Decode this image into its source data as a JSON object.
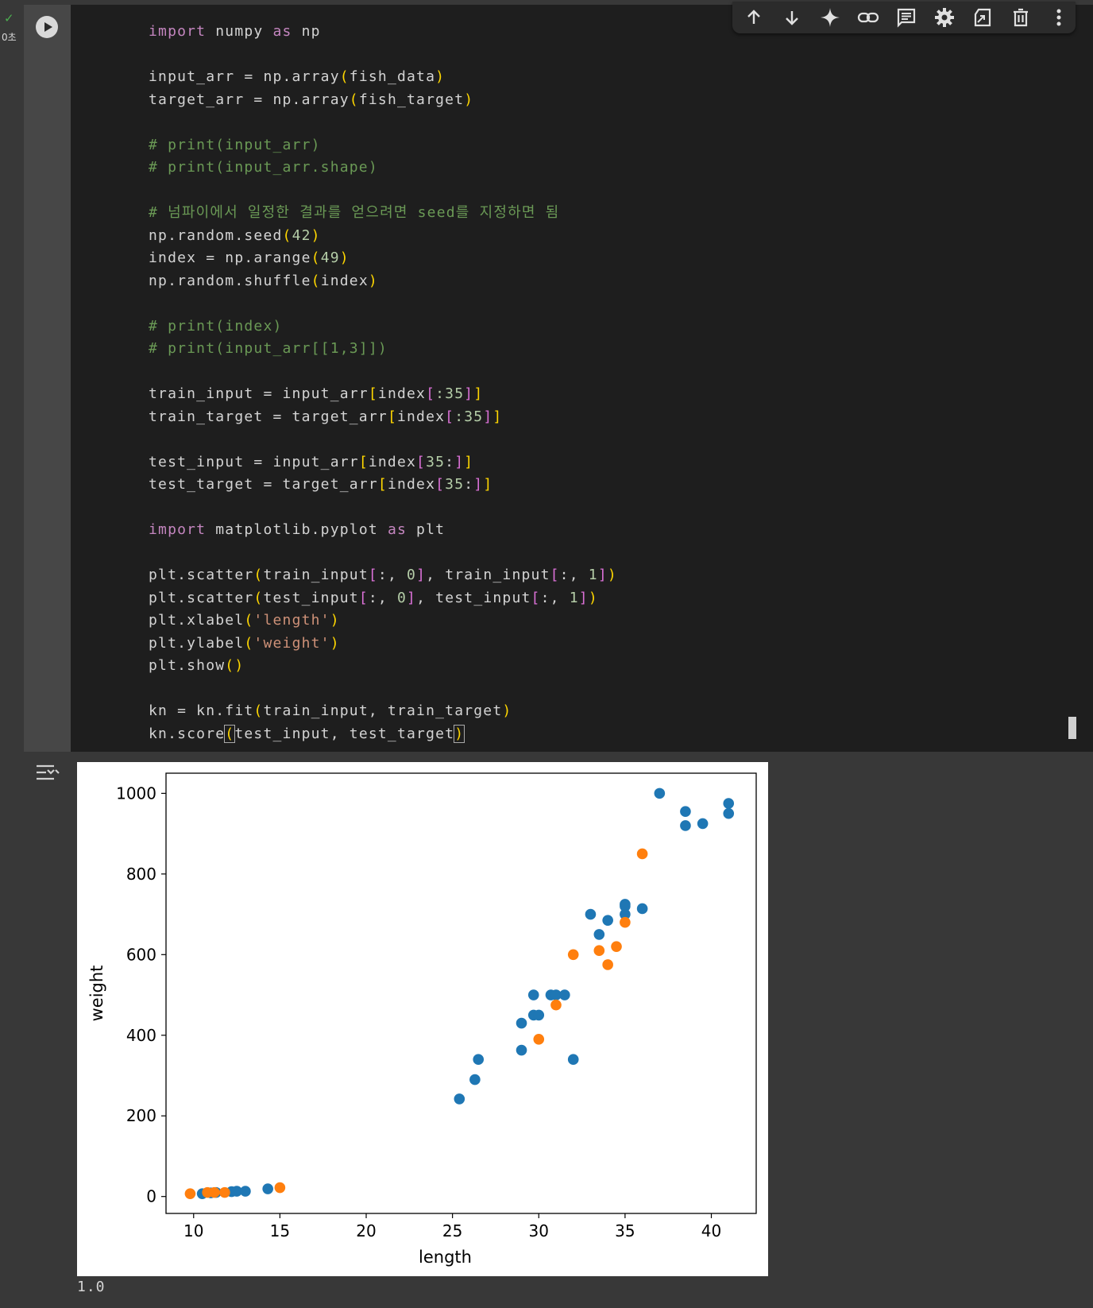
{
  "cell": {
    "status_check": "✓",
    "exec_time": "0초",
    "code_lines": [
      [
        {
          "t": "import",
          "c": "k"
        },
        {
          "t": " numpy "
        },
        {
          "t": "as",
          "c": "k"
        },
        {
          "t": " np"
        }
      ],
      [],
      [
        {
          "t": "input_arr = np.array"
        },
        {
          "t": "(",
          "c": "p1"
        },
        {
          "t": "fish_data"
        },
        {
          "t": ")",
          "c": "p1"
        }
      ],
      [
        {
          "t": "target_arr = np.array"
        },
        {
          "t": "(",
          "c": "p1"
        },
        {
          "t": "fish_target"
        },
        {
          "t": ")",
          "c": "p1"
        }
      ],
      [],
      [
        {
          "t": "# print(input_arr)",
          "c": "c"
        }
      ],
      [
        {
          "t": "# print(input_arr.shape)",
          "c": "c"
        }
      ],
      [],
      [
        {
          "t": "# 넘파이에서 일정한 결과를 얻으려면 seed를 지정하면 됨",
          "c": "c"
        }
      ],
      [
        {
          "t": "np.random.seed"
        },
        {
          "t": "(",
          "c": "p1"
        },
        {
          "t": "42",
          "c": "n"
        },
        {
          "t": ")",
          "c": "p1"
        }
      ],
      [
        {
          "t": "index = np.arange"
        },
        {
          "t": "(",
          "c": "p1"
        },
        {
          "t": "49",
          "c": "n"
        },
        {
          "t": ")",
          "c": "p1"
        }
      ],
      [
        {
          "t": "np.random.shuffle"
        },
        {
          "t": "(",
          "c": "p1"
        },
        {
          "t": "index"
        },
        {
          "t": ")",
          "c": "p1"
        }
      ],
      [],
      [
        {
          "t": "# print(index)",
          "c": "c"
        }
      ],
      [
        {
          "t": "# print(input_arr[[1,3]])",
          "c": "c"
        }
      ],
      [],
      [
        {
          "t": "train_input = input_arr"
        },
        {
          "t": "[",
          "c": "p1"
        },
        {
          "t": "index"
        },
        {
          "t": "[",
          "c": "p2"
        },
        {
          "t": ":35",
          "c": "n"
        },
        {
          "t": "]",
          "c": "p2"
        },
        {
          "t": "]",
          "c": "p1"
        }
      ],
      [
        {
          "t": "train_target = target_arr"
        },
        {
          "t": "[",
          "c": "p1"
        },
        {
          "t": "index"
        },
        {
          "t": "[",
          "c": "p2"
        },
        {
          "t": ":35",
          "c": "n"
        },
        {
          "t": "]",
          "c": "p2"
        },
        {
          "t": "]",
          "c": "p1"
        }
      ],
      [],
      [
        {
          "t": "test_input = input_arr"
        },
        {
          "t": "[",
          "c": "p1"
        },
        {
          "t": "index"
        },
        {
          "t": "[",
          "c": "p2"
        },
        {
          "t": "35",
          "c": "n"
        },
        {
          "t": ":"
        },
        {
          "t": "]",
          "c": "p2"
        },
        {
          "t": "]",
          "c": "p1"
        }
      ],
      [
        {
          "t": "test_target = target_arr"
        },
        {
          "t": "[",
          "c": "p1"
        },
        {
          "t": "index"
        },
        {
          "t": "[",
          "c": "p2"
        },
        {
          "t": "35",
          "c": "n"
        },
        {
          "t": ":"
        },
        {
          "t": "]",
          "c": "p2"
        },
        {
          "t": "]",
          "c": "p1"
        }
      ],
      [],
      [
        {
          "t": "import",
          "c": "k"
        },
        {
          "t": " matplotlib.pyplot "
        },
        {
          "t": "as",
          "c": "k"
        },
        {
          "t": " plt"
        }
      ],
      [],
      [
        {
          "t": "plt.scatter"
        },
        {
          "t": "(",
          "c": "p1"
        },
        {
          "t": "train_input"
        },
        {
          "t": "[",
          "c": "p2"
        },
        {
          "t": ":, "
        },
        {
          "t": "0",
          "c": "n"
        },
        {
          "t": "]",
          "c": "p2"
        },
        {
          "t": ", train_input"
        },
        {
          "t": "[",
          "c": "p2"
        },
        {
          "t": ":, "
        },
        {
          "t": "1",
          "c": "n"
        },
        {
          "t": "]",
          "c": "p2"
        },
        {
          "t": ")",
          "c": "p1"
        }
      ],
      [
        {
          "t": "plt.scatter"
        },
        {
          "t": "(",
          "c": "p1"
        },
        {
          "t": "test_input"
        },
        {
          "t": "[",
          "c": "p2"
        },
        {
          "t": ":, "
        },
        {
          "t": "0",
          "c": "n"
        },
        {
          "t": "]",
          "c": "p2"
        },
        {
          "t": ", test_input"
        },
        {
          "t": "[",
          "c": "p2"
        },
        {
          "t": ":, "
        },
        {
          "t": "1",
          "c": "n"
        },
        {
          "t": "]",
          "c": "p2"
        },
        {
          "t": ")",
          "c": "p1"
        }
      ],
      [
        {
          "t": "plt.xlabel"
        },
        {
          "t": "(",
          "c": "p1"
        },
        {
          "t": "'length'",
          "c": "s"
        },
        {
          "t": ")",
          "c": "p1"
        }
      ],
      [
        {
          "t": "plt.ylabel"
        },
        {
          "t": "(",
          "c": "p1"
        },
        {
          "t": "'weight'",
          "c": "s"
        },
        {
          "t": ")",
          "c": "p1"
        }
      ],
      [
        {
          "t": "plt.show"
        },
        {
          "t": "()",
          "c": "p1"
        }
      ],
      [],
      [
        {
          "t": "kn = kn.fit"
        },
        {
          "t": "(",
          "c": "p1"
        },
        {
          "t": "train_input, train_target"
        },
        {
          "t": ")",
          "c": "p1"
        }
      ],
      [
        {
          "t": "kn.score"
        },
        {
          "t": "(",
          "c": "cursor"
        },
        {
          "t": "test_input, test_target"
        },
        {
          "t": ")",
          "c": "cursor"
        }
      ]
    ]
  },
  "toolbar": {
    "buttons": [
      "move-up",
      "move-down",
      "gemini-sparkle",
      "link",
      "comment",
      "settings",
      "mirror-cell",
      "delete",
      "more"
    ]
  },
  "output": {
    "result_text": "1.0"
  },
  "chart_data": {
    "type": "scatter",
    "xlabel": "length",
    "ylabel": "weight",
    "xlim": [
      8.4,
      42.6
    ],
    "ylim": [
      -42,
      1050
    ],
    "xticks": [
      10,
      15,
      20,
      25,
      30,
      35,
      40
    ],
    "yticks": [
      0,
      200,
      400,
      600,
      800,
      1000
    ],
    "series": [
      {
        "color": "#1f77b4",
        "points": [
          [
            10.5,
            7
          ],
          [
            11.0,
            9
          ],
          [
            11.3,
            10
          ],
          [
            12.2,
            12
          ],
          [
            12.5,
            13
          ],
          [
            13.0,
            13
          ],
          [
            14.3,
            19
          ],
          [
            25.4,
            242
          ],
          [
            26.3,
            290
          ],
          [
            26.5,
            340
          ],
          [
            29.0,
            363
          ],
          [
            29.0,
            430
          ],
          [
            29.7,
            450
          ],
          [
            29.7,
            500
          ],
          [
            30.0,
            450
          ],
          [
            30.7,
            500
          ],
          [
            31.0,
            500
          ],
          [
            31.5,
            500
          ],
          [
            32.0,
            340
          ],
          [
            33.0,
            700
          ],
          [
            33.5,
            650
          ],
          [
            34.0,
            685
          ],
          [
            35.0,
            700
          ],
          [
            35.0,
            725
          ],
          [
            35.0,
            720
          ],
          [
            36.0,
            714
          ],
          [
            37.0,
            1000
          ],
          [
            38.5,
            955
          ],
          [
            38.5,
            920
          ],
          [
            39.5,
            925
          ],
          [
            41.0,
            975
          ],
          [
            41.0,
            950
          ]
        ]
      },
      {
        "color": "#ff7f0e",
        "points": [
          [
            9.8,
            7
          ],
          [
            10.8,
            10
          ],
          [
            11.2,
            10
          ],
          [
            11.8,
            10
          ],
          [
            15.0,
            22
          ],
          [
            30.0,
            390
          ],
          [
            31.0,
            475
          ],
          [
            32.0,
            600
          ],
          [
            33.5,
            610
          ],
          [
            34.0,
            575
          ],
          [
            34.5,
            620
          ],
          [
            35.0,
            680
          ],
          [
            36.0,
            850
          ]
        ]
      }
    ]
  }
}
